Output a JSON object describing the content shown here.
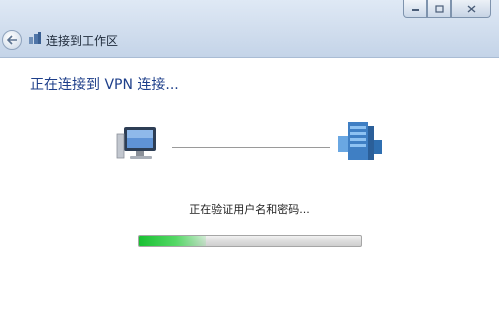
{
  "window": {
    "title": "连接到工作区",
    "controls": {
      "minimize_icon": "minimize-icon",
      "maximize_icon": "maximize-icon",
      "close_icon": "close-icon"
    }
  },
  "main": {
    "heading": "正在连接到 VPN 连接...",
    "status": "正在验证用户名和密码...",
    "progress_fraction": 0.3
  },
  "colors": {
    "heading": "#1e3f8a",
    "progress": "#19c032",
    "titlebar": "#cfdced"
  }
}
